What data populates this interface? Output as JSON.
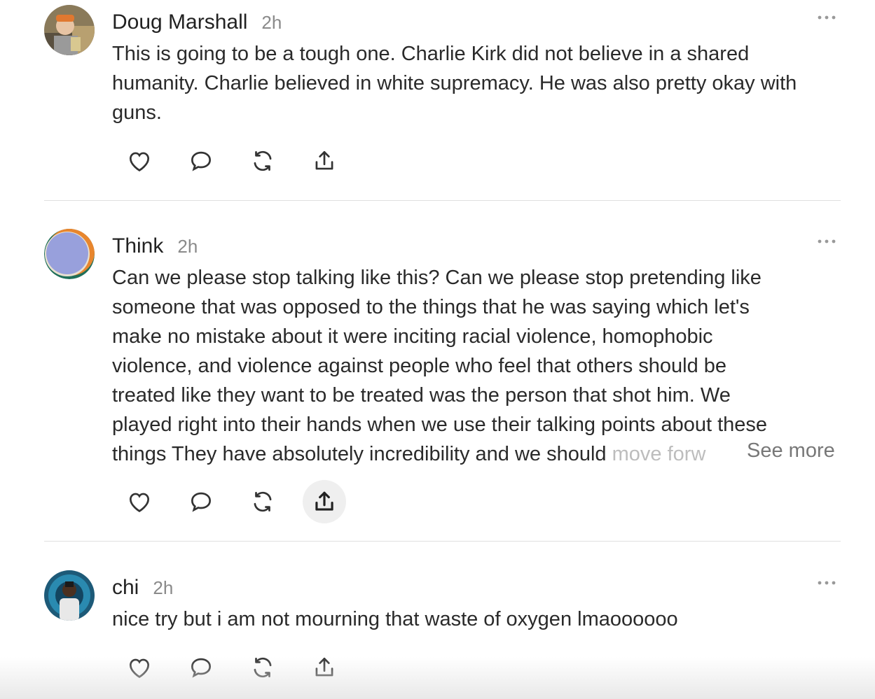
{
  "posts": [
    {
      "author": "Doug Marshall",
      "time": "2h",
      "text_lines": [
        "This is going to be a tough one. Charlie Kirk did not believe in a shared",
        "humanity. Charlie believed in white supremacy. He was also pretty okay with",
        "guns."
      ]
    },
    {
      "author": "Think",
      "time": "2h",
      "text_lines": [
        "Can we please stop talking like this? Can we please stop pretending like",
        "someone that was opposed to the things that he was saying which let's",
        "make no mistake about it were inciting racial violence, homophobic",
        "violence, and violence against people who feel that others should be",
        "treated like they want to be treated was the person that shot him. We",
        "played right into their hands when we use their talking points about these"
      ],
      "last_line_visible": "things They have absolutely incredibility and we should ",
      "last_line_faded": "move forw",
      "see_more": "See more"
    },
    {
      "author": "chi",
      "time": "2h",
      "text_lines": [
        "nice try but i am not mourning that waste of oxygen lmaoooooo"
      ]
    }
  ],
  "icons": {
    "like": "heart-icon",
    "reply": "comment-icon",
    "repost": "repost-icon",
    "share": "share-icon",
    "more": "more-icon"
  },
  "colors": {
    "text": "#2a2a2a",
    "muted": "#8a8a8a",
    "icon": "#333333",
    "divider": "#e0e0e0",
    "hover_bg": "#efefef"
  }
}
